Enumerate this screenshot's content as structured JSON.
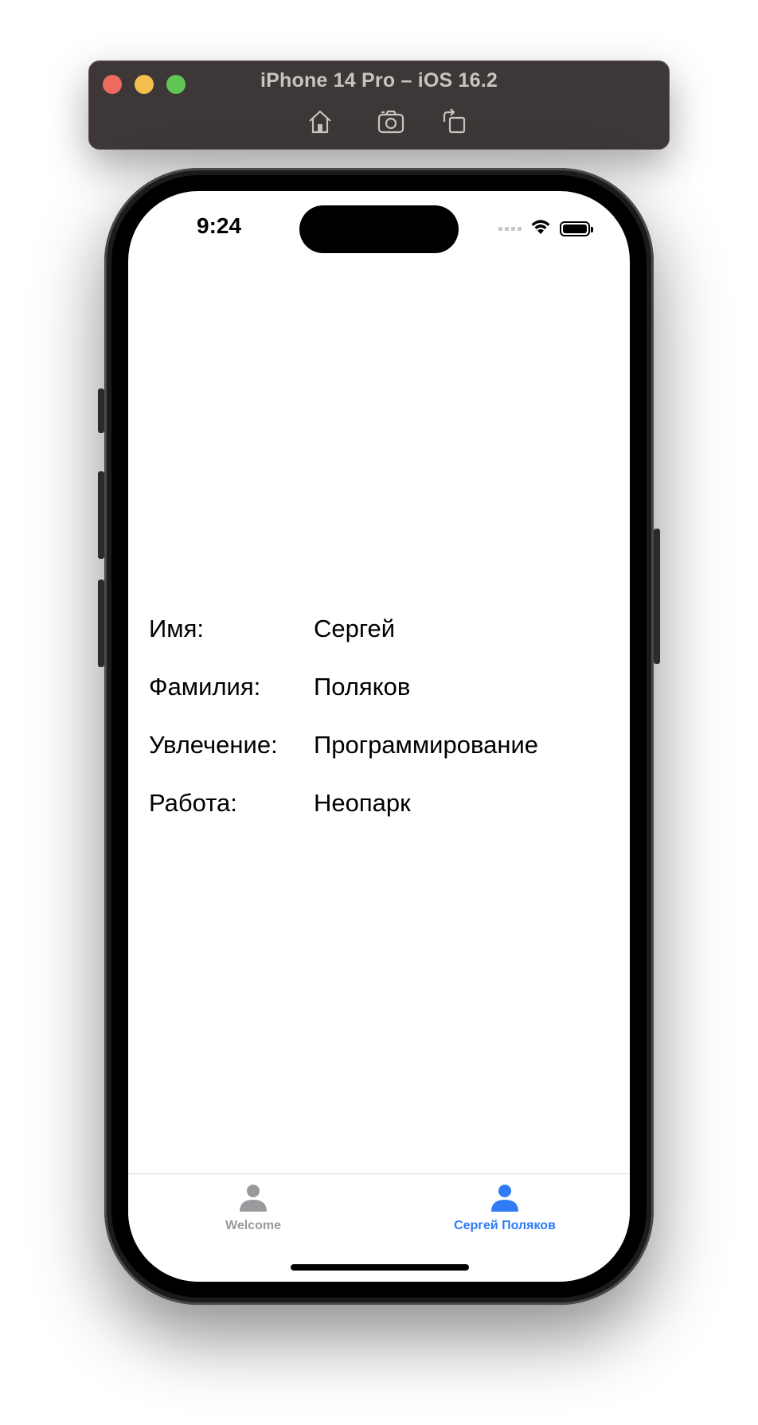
{
  "simulator": {
    "title": "iPhone 14 Pro – iOS 16.2",
    "toolbar": {
      "home_icon": "home-icon",
      "screenshot_icon": "camera-icon",
      "rotate_icon": "rotate-icon"
    }
  },
  "status_bar": {
    "time": "9:24"
  },
  "profile": {
    "rows": [
      {
        "label": "Имя:",
        "value": "Сергей"
      },
      {
        "label": "Фамилия:",
        "value": "Поляков"
      },
      {
        "label": "Увлечение:",
        "value": "Программирование"
      },
      {
        "label": "Работа:",
        "value": "Неопарк"
      }
    ]
  },
  "tab_bar": {
    "tabs": [
      {
        "label": "Welcome",
        "icon": "person-icon",
        "selected": false
      },
      {
        "label": "Сергей Поляков",
        "icon": "person-icon",
        "selected": true
      }
    ]
  },
  "colors": {
    "accent": "#2f7cf6",
    "inactive_tab": "#9a9a9e",
    "titlebar": "#3d3837"
  }
}
